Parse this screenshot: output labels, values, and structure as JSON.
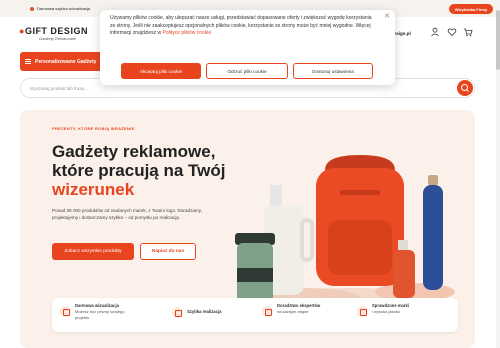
{
  "topbar": {
    "free_shipping": "Darmowa szybka wizualizacja",
    "partner_button": "Wizytówka Firmy"
  },
  "header": {
    "logo_text": "GIFT DESIGN",
    "logo_tagline": "Gadżety Reklamowe",
    "email_fragment": "design.pl",
    "icons": [
      "user-icon",
      "heart-icon",
      "cart-icon"
    ]
  },
  "nav": {
    "category_button": "Personalizowane Gadżety"
  },
  "search": {
    "placeholder": "Wyszukaj produkt lub frazę..."
  },
  "hero": {
    "kicker": "PREZENTY, KTÓRE ROBIĄ WRAŻENIE",
    "title_line1": "Gadżety reklamowe,",
    "title_line2": "które pracują na Twój",
    "title_accent": "wizerunek",
    "description": "Ponad 35 000 produktów od zaufanych marek, z Twoim logo. Doradzamy, projektujemy i dostarczamy szybko – od pomysłu po realizację.",
    "primary_button": "Zobacz wszystkie produkty",
    "secondary_button": "Napisz do nas"
  },
  "features": [
    {
      "icon": "visualization-icon",
      "title": "Darmowa wizualizacja",
      "desc": "Możesz być pewny swojego projektu"
    },
    {
      "icon": "speed-icon",
      "title": "Szybka realizacja",
      "desc": ""
    },
    {
      "icon": "advisor-icon",
      "title": "Doradztwo ekspertów",
      "desc": "na każdym etapie"
    },
    {
      "icon": "brands-icon",
      "title": "Sprawdzone marki",
      "desc": "i wysoka jakość"
    }
  ],
  "cookie": {
    "text": "Używamy plików cookie, aby ulepszać nasze usługi, przedstawiać dopasowane oferty i zwiększać wygodę korzystania ze strony. Jeśli nie zaakceptujesz opcjonalnych plików cookie, korzystanie ze strony może być mniej wygodne. Więcej informacji znajdziesz w",
    "link": "Polityce plików cookie",
    "accept": "Akceptuj pliki cookie",
    "reject": "Odrzuć pliki cookie",
    "settings": "Dostosuj ustawienia"
  },
  "colors": {
    "accent": "#e8451f",
    "hero_bg": "#fbf1ea"
  }
}
